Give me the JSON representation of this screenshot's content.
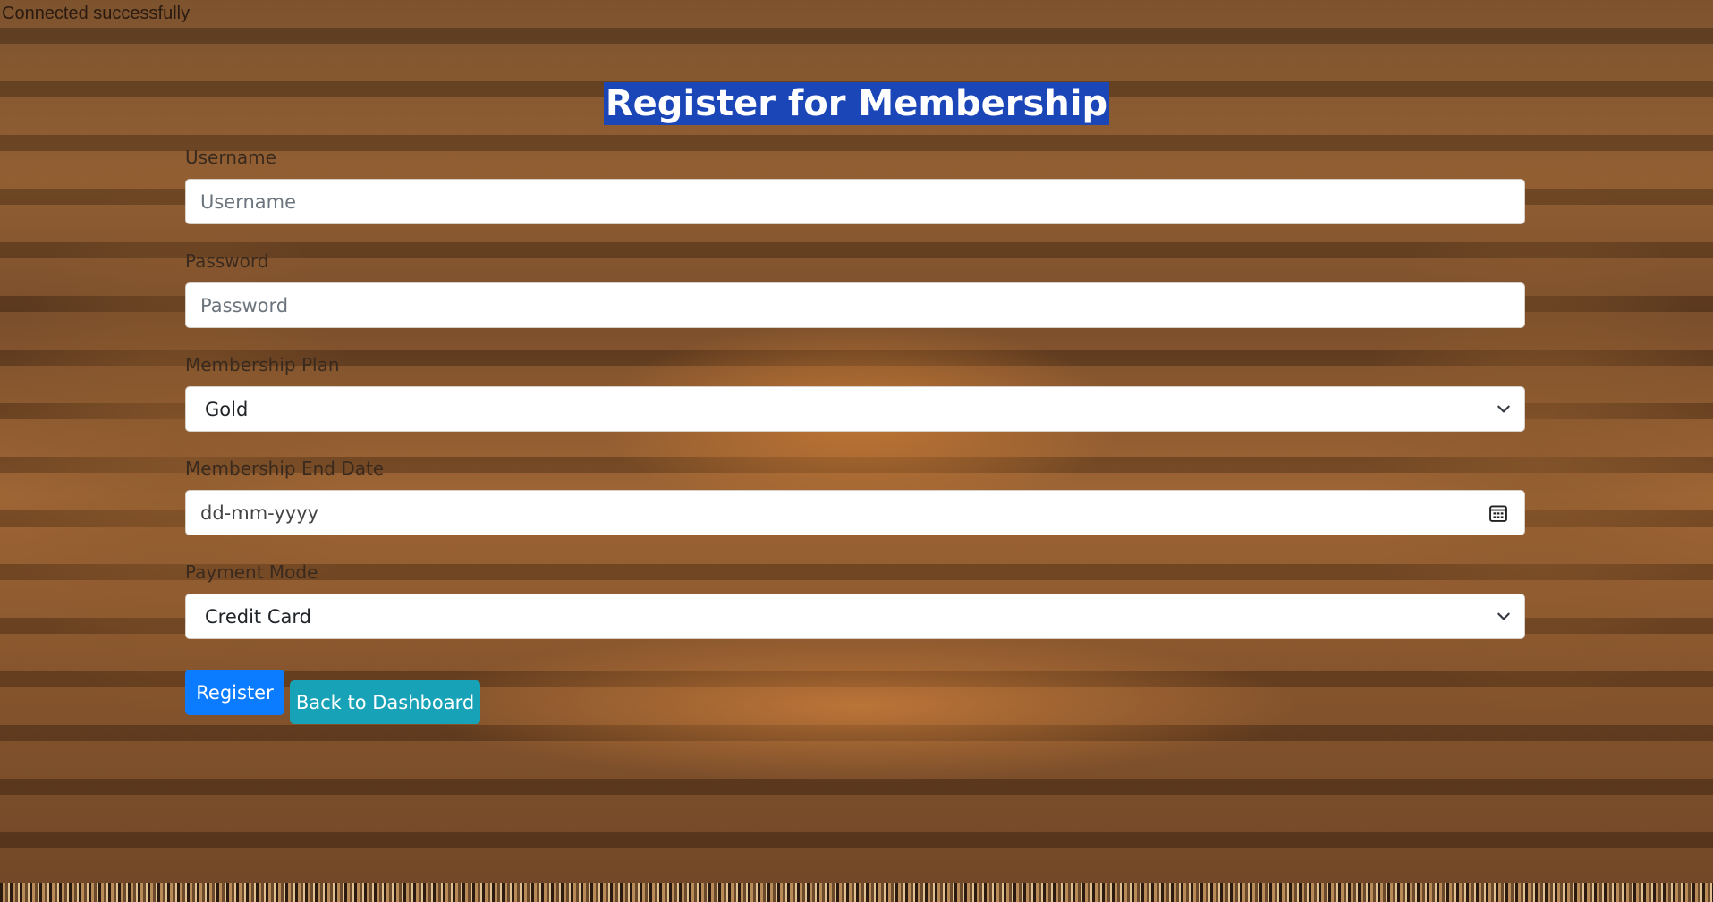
{
  "status_message": "Connected successfully",
  "page_title": "Register for Membership",
  "form": {
    "username": {
      "label": "Username",
      "placeholder": "Username",
      "value": ""
    },
    "password": {
      "label": "Password",
      "placeholder": "Password",
      "value": ""
    },
    "membership_plan": {
      "label": "Membership Plan",
      "selected": "Gold"
    },
    "membership_end_date": {
      "label": "Membership End Date",
      "placeholder": "dd-mm-yyyy"
    },
    "payment_mode": {
      "label": "Payment Mode",
      "selected": "Credit Card"
    }
  },
  "buttons": {
    "register": "Register",
    "back_to_dashboard": "Back to Dashboard"
  },
  "icons": {
    "select_arrow": "chevron-down-icon",
    "date_picker": "calendar-icon"
  },
  "colors": {
    "title_highlight": "#1b46b8",
    "primary_button": "#0b7cff",
    "info_button": "#17a2b8"
  }
}
